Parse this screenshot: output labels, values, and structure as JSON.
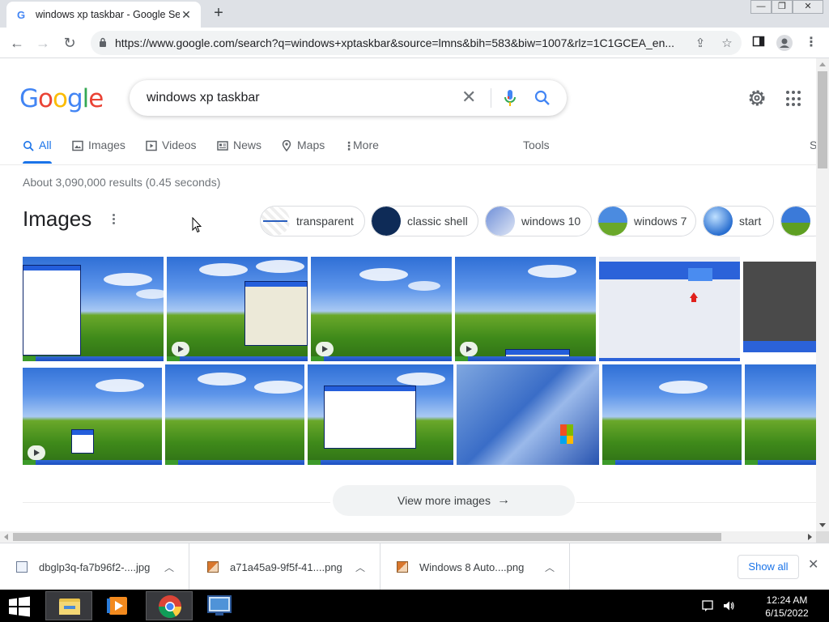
{
  "browser": {
    "tab_title": "windows xp taskbar - Google Sea",
    "tab_favicon": "G",
    "new_tab": "+",
    "url": "https://www.google.com/search?q=windows+xptaskbar&source=lmns&bih=583&biw=1007&rlz=1C1GCEA_en...",
    "window_controls": [
      "minimize",
      "maximize",
      "close"
    ]
  },
  "search": {
    "query": "windows xp taskbar",
    "clear": "✕"
  },
  "logo": {
    "letters": [
      "G",
      "o",
      "o",
      "g",
      "l",
      "e"
    ],
    "colors": [
      "#4285f4",
      "#ea4335",
      "#fbbc05",
      "#4285f4",
      "#34a853",
      "#ea4335"
    ]
  },
  "tabs": [
    {
      "label": "All",
      "icon": "search-icon",
      "active": true
    },
    {
      "label": "Images",
      "icon": "image-icon"
    },
    {
      "label": "Videos",
      "icon": "video-icon"
    },
    {
      "label": "News",
      "icon": "news-icon"
    },
    {
      "label": "Maps",
      "icon": "map-pin-icon"
    },
    {
      "label": "More",
      "icon": "more-vert-icon"
    }
  ],
  "tools_label": "Tools",
  "tools_extra": "S",
  "stats": "About 3,090,000 results (0.45 seconds)",
  "images_heading": "Images",
  "chips": [
    "transparent",
    "classic shell",
    "windows 10",
    "windows 7",
    "start"
  ],
  "view_more": "View more images",
  "downloads": [
    {
      "name": "dbglp3q-fa7b96f2-....jpg",
      "type": "jpg"
    },
    {
      "name": "a71a45a9-9f5f-41....png",
      "type": "png"
    },
    {
      "name": "Windows 8 Auto....png",
      "type": "png"
    }
  ],
  "show_all": "Show all",
  "clock": {
    "time": "12:24 AM",
    "date": "6/15/2022"
  },
  "colors": {
    "accent": "#1a73e8",
    "chrome_bg": "#dee1e6"
  }
}
